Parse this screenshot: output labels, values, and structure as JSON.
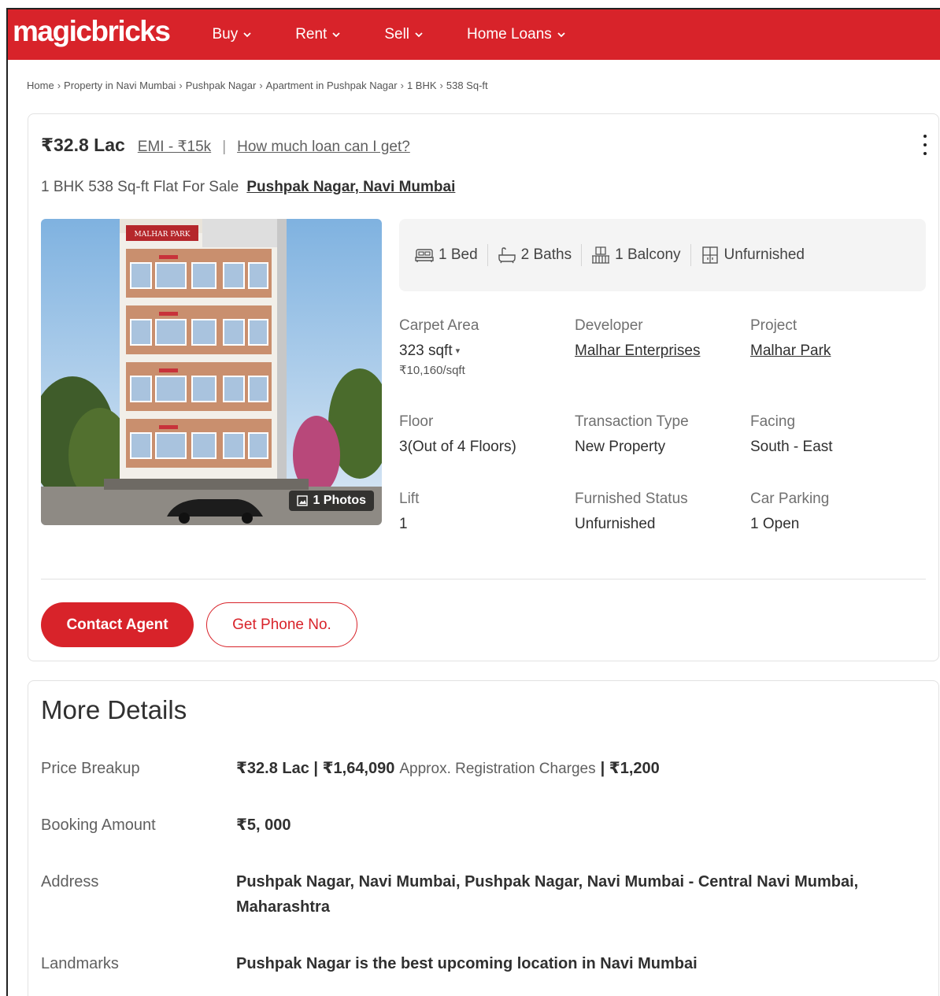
{
  "header": {
    "logo": "magicbricks",
    "nav": [
      {
        "label": "Buy"
      },
      {
        "label": "Rent"
      },
      {
        "label": "Sell"
      },
      {
        "label": "Home Loans"
      }
    ]
  },
  "breadcrumb": [
    "Home",
    "Property in Navi Mumbai",
    "Pushpak Nagar",
    "Apartment in Pushpak Nagar",
    "1 BHK",
    "538 Sq-ft"
  ],
  "listing": {
    "price": "₹32.8 Lac",
    "emi": "EMI - ₹15k",
    "separator": "|",
    "loan_link": "How much loan can I get?",
    "title": "1 BHK 538 Sq-ft Flat For Sale",
    "location_link": "Pushpak Nagar, Navi Mumbai",
    "photo_count": "1 Photos",
    "photo_sign_text": "MALHAR PARK",
    "amenities": [
      {
        "icon": "bed-icon",
        "label": "1 Bed"
      },
      {
        "icon": "bath-icon",
        "label": "2 Baths"
      },
      {
        "icon": "balcony-icon",
        "label": "1 Balcony"
      },
      {
        "icon": "furnishing-icon",
        "label": "Unfurnished"
      }
    ],
    "summary": {
      "carpet_area": {
        "label": "Carpet Area",
        "value": "323 sqft",
        "sub": "₹10,160/sqft"
      },
      "developer": {
        "label": "Developer",
        "value": "Malhar Enterprises"
      },
      "project": {
        "label": "Project",
        "value": "Malhar Park"
      },
      "floor": {
        "label": "Floor",
        "value": "3(Out of 4 Floors)"
      },
      "transaction": {
        "label": "Transaction Type",
        "value": "New Property"
      },
      "facing": {
        "label": "Facing",
        "value": "South - East"
      },
      "lift": {
        "label": "Lift",
        "value": "1"
      },
      "furnished": {
        "label": "Furnished Status",
        "value": "Unfurnished"
      },
      "parking": {
        "label": "Car Parking",
        "value": "1 Open"
      }
    },
    "contact_button": "Contact Agent",
    "phone_button": "Get Phone No."
  },
  "more_details": {
    "title": "More Details",
    "price_breakup": {
      "label": "Price Breakup",
      "price": "₹32.8 Lac",
      "registration": "₹1,64,090",
      "registration_label": "Approx. Registration Charges",
      "other": "₹1,200"
    },
    "booking": {
      "label": "Booking Amount",
      "value": "₹5, 000"
    },
    "address": {
      "label": "Address",
      "value": "Pushpak Nagar, Navi Mumbai, Pushpak Nagar, Navi Mumbai - Central Navi Mumbai, Maharashtra"
    },
    "landmarks": {
      "label": "Landmarks",
      "value": "Pushpak Nagar is the best upcoming location in Navi Mumbai"
    }
  },
  "colors": {
    "brand": "#d8232a",
    "text": "#303030",
    "muted": "#707070",
    "panel": "#f4f4f4"
  }
}
